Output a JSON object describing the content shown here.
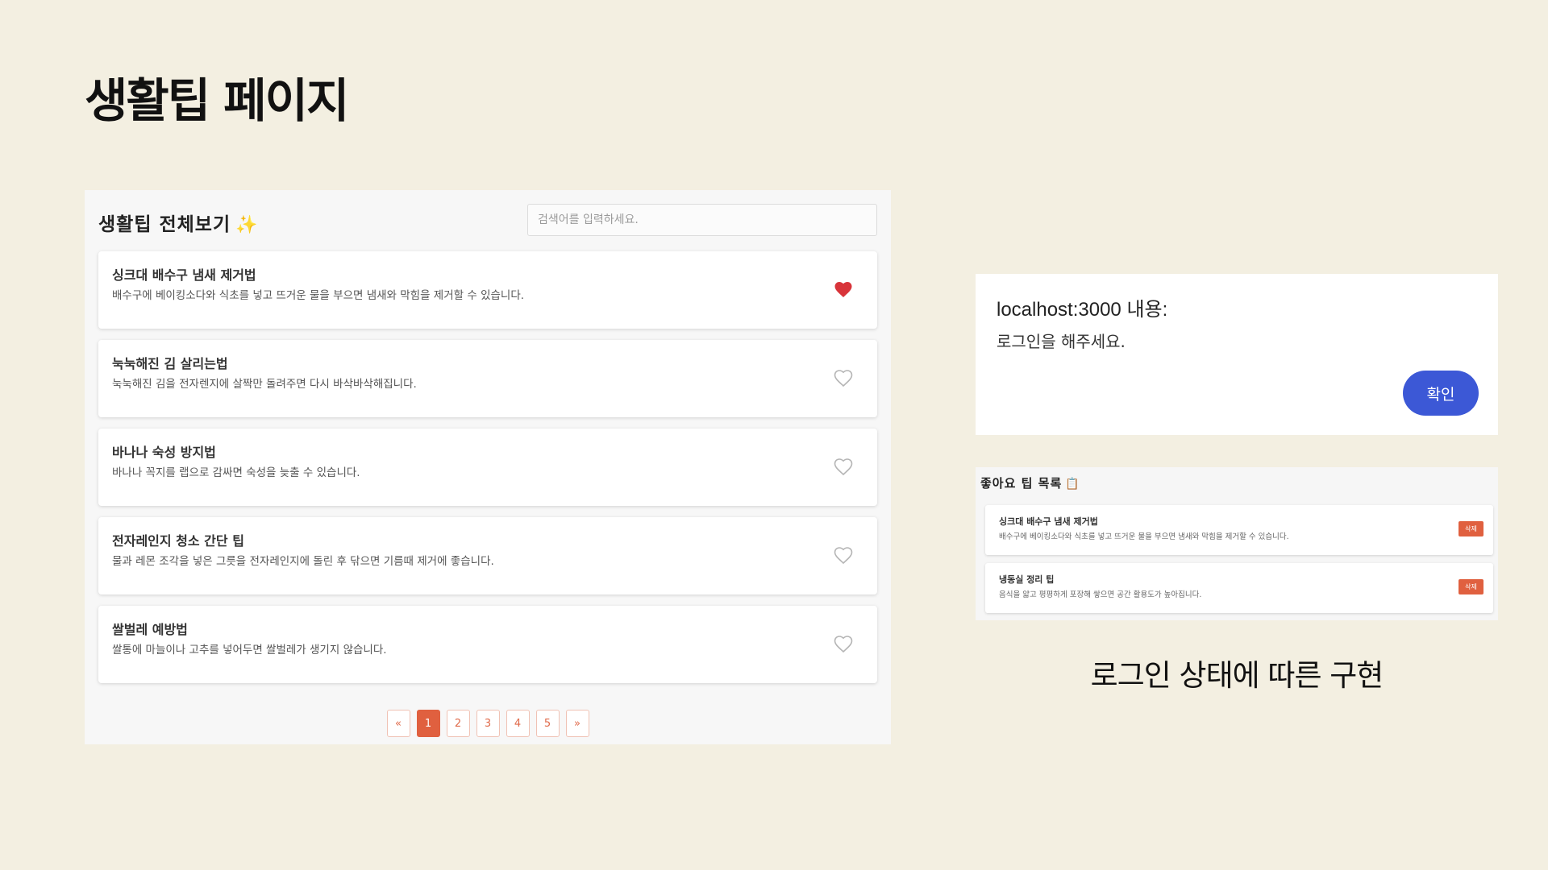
{
  "slide": {
    "title": "생활팁 페이지",
    "caption": "로그인 상태에 따른 구현"
  },
  "tips_panel": {
    "title": "생활팁 전체보기",
    "title_emoji": "✨",
    "search_placeholder": "검색어를 입력하세요.",
    "tips": [
      {
        "title": "싱크대 배수구 냄새 제거법",
        "description": "배수구에 베이킹소다와 식초를 넣고 뜨거운 물을 부으면 냄새와 막힘을 제거할 수 있습니다.",
        "liked": true
      },
      {
        "title": "눅눅해진 김 살리는법",
        "description": "눅눅해진 김을 전자렌지에 살짝만 돌려주면 다시 바삭바삭해집니다.",
        "liked": false
      },
      {
        "title": "바나나 숙성 방지법",
        "description": "바나나 꼭지를 랩으로 감싸면 숙성을 늦출 수 있습니다.",
        "liked": false
      },
      {
        "title": "전자레인지 청소 간단 팁",
        "description": "물과 레몬 조각을 넣은 그릇을 전자레인지에 돌린 후 닦으면 기름때 제거에 좋습니다.",
        "liked": false
      },
      {
        "title": "쌀벌레 예방법",
        "description": "쌀통에 마늘이나 고추를 넣어두면 쌀벌레가 생기지 않습니다.",
        "liked": false
      }
    ],
    "pagination": {
      "prev": "«",
      "pages": [
        "1",
        "2",
        "3",
        "4",
        "5"
      ],
      "current": "1",
      "next": "»"
    }
  },
  "alert_dialog": {
    "origin": "localhost:3000 내용:",
    "message": "로그인을 해주세요.",
    "confirm_label": "확인"
  },
  "liked_panel": {
    "title": "좋아요 팁 목록",
    "title_emoji": "📋",
    "items": [
      {
        "title": "싱크대 배수구 냄새 제거법",
        "description": "배수구에 베이킹소다와 식초를 넣고 뜨거운 물을 부으면 냄새와 막힘을 제거할 수 있습니다.",
        "delete_label": "삭제"
      },
      {
        "title": "냉동실 정리 팁",
        "description": "음식을 얇고 평평하게 포장해 쌓으면 공간 활용도가 높아집니다.",
        "delete_label": "삭제"
      }
    ]
  },
  "colors": {
    "background": "#f3efe1",
    "accent": "#e0603f",
    "heart_filled": "#d8343a",
    "heart_outline": "#b5b5b5",
    "confirm_button": "#3c58d6"
  }
}
